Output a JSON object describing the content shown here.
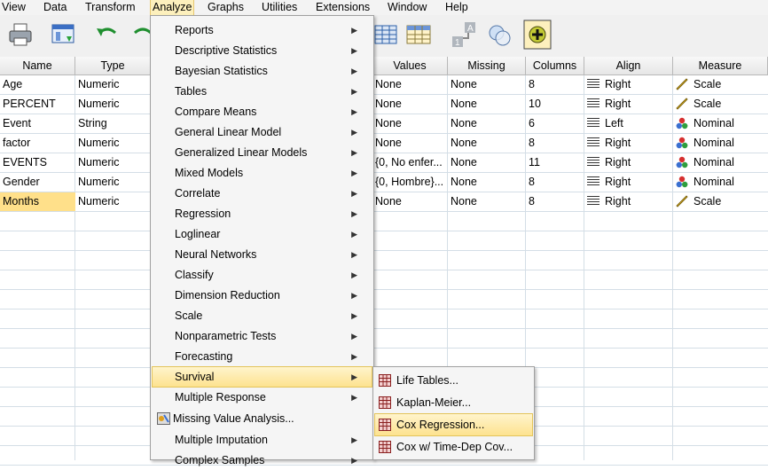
{
  "menubar": [
    {
      "label": "View",
      "active": false
    },
    {
      "label": "Data",
      "active": false
    },
    {
      "label": "Transform",
      "active": false
    },
    {
      "label": "Analyze",
      "active": true
    },
    {
      "label": "Graphs",
      "active": false
    },
    {
      "label": "Utilities",
      "active": false
    },
    {
      "label": "Extensions",
      "active": false
    },
    {
      "label": "Window",
      "active": false
    },
    {
      "label": "Help",
      "active": false
    }
  ],
  "grid": {
    "columns": [
      "Name",
      "Type",
      "Values",
      "Missing",
      "Columns",
      "Align",
      "Measure"
    ],
    "rows": [
      {
        "name": "Age",
        "type": "Numeric",
        "values": "None",
        "missing": "None",
        "columns": "8",
        "align": "Right",
        "measure": "Scale"
      },
      {
        "name": "PERCENT",
        "type": "Numeric",
        "values": "None",
        "missing": "None",
        "columns": "10",
        "align": "Right",
        "measure": "Scale"
      },
      {
        "name": "Event",
        "type": "String",
        "values": "None",
        "missing": "None",
        "columns": "6",
        "align": "Left",
        "measure": "Nominal"
      },
      {
        "name": "factor",
        "type": "Numeric",
        "values": "None",
        "missing": "None",
        "columns": "8",
        "align": "Right",
        "measure": "Nominal"
      },
      {
        "name": "EVENTS",
        "type": "Numeric",
        "values": "{0, No enfer...",
        "missing": "None",
        "columns": "11",
        "align": "Right",
        "measure": "Nominal"
      },
      {
        "name": "Gender",
        "type": "Numeric",
        "values": "{0, Hombre}...",
        "missing": "None",
        "columns": "8",
        "align": "Right",
        "measure": "Nominal"
      },
      {
        "name": "Months",
        "type": "Numeric",
        "values": "None",
        "missing": "None",
        "columns": "8",
        "align": "Right",
        "measure": "Scale"
      }
    ],
    "selected_row": 6
  },
  "analyze_menu": {
    "items": [
      {
        "label": "Reports",
        "submenu": true
      },
      {
        "label": "Descriptive Statistics",
        "submenu": true
      },
      {
        "label": "Bayesian Statistics",
        "submenu": true
      },
      {
        "label": "Tables",
        "submenu": true
      },
      {
        "label": "Compare Means",
        "submenu": true
      },
      {
        "label": "General Linear Model",
        "submenu": true
      },
      {
        "label": "Generalized Linear Models",
        "submenu": true
      },
      {
        "label": "Mixed Models",
        "submenu": true
      },
      {
        "label": "Correlate",
        "submenu": true
      },
      {
        "label": "Regression",
        "submenu": true
      },
      {
        "label": "Loglinear",
        "submenu": true
      },
      {
        "label": "Neural Networks",
        "submenu": true
      },
      {
        "label": "Classify",
        "submenu": true
      },
      {
        "label": "Dimension Reduction",
        "submenu": true
      },
      {
        "label": "Scale",
        "submenu": true
      },
      {
        "label": "Nonparametric Tests",
        "submenu": true
      },
      {
        "label": "Forecasting",
        "submenu": true
      },
      {
        "label": "Survival",
        "submenu": true,
        "highlighted": true
      },
      {
        "label": "Multiple Response",
        "submenu": true
      },
      {
        "label": "Missing Value Analysis...",
        "submenu": false,
        "icon": "missing-value-icon"
      },
      {
        "label": "Multiple Imputation",
        "submenu": true
      },
      {
        "label": "Complex Samples",
        "submenu": true
      }
    ]
  },
  "survival_submenu": {
    "items": [
      {
        "label": "Life Tables...",
        "highlighted": false
      },
      {
        "label": "Kaplan-Meier...",
        "highlighted": false
      },
      {
        "label": "Cox Regression...",
        "highlighted": true
      },
      {
        "label": "Cox w/ Time-Dep Cov...",
        "highlighted": false
      }
    ]
  },
  "toolbar_icons": [
    "print-icon",
    "data-editor-icon",
    "undo-icon",
    "redo-icon",
    "grid-table-icon",
    "grid-table-2-icon",
    "value-labels-icon",
    "sets-icon",
    "add-circle-icon"
  ],
  "colors": {
    "selection": "#ffe08a",
    "menu_highlight": "#fde28f",
    "menubar_active": "#fdf0bd"
  }
}
